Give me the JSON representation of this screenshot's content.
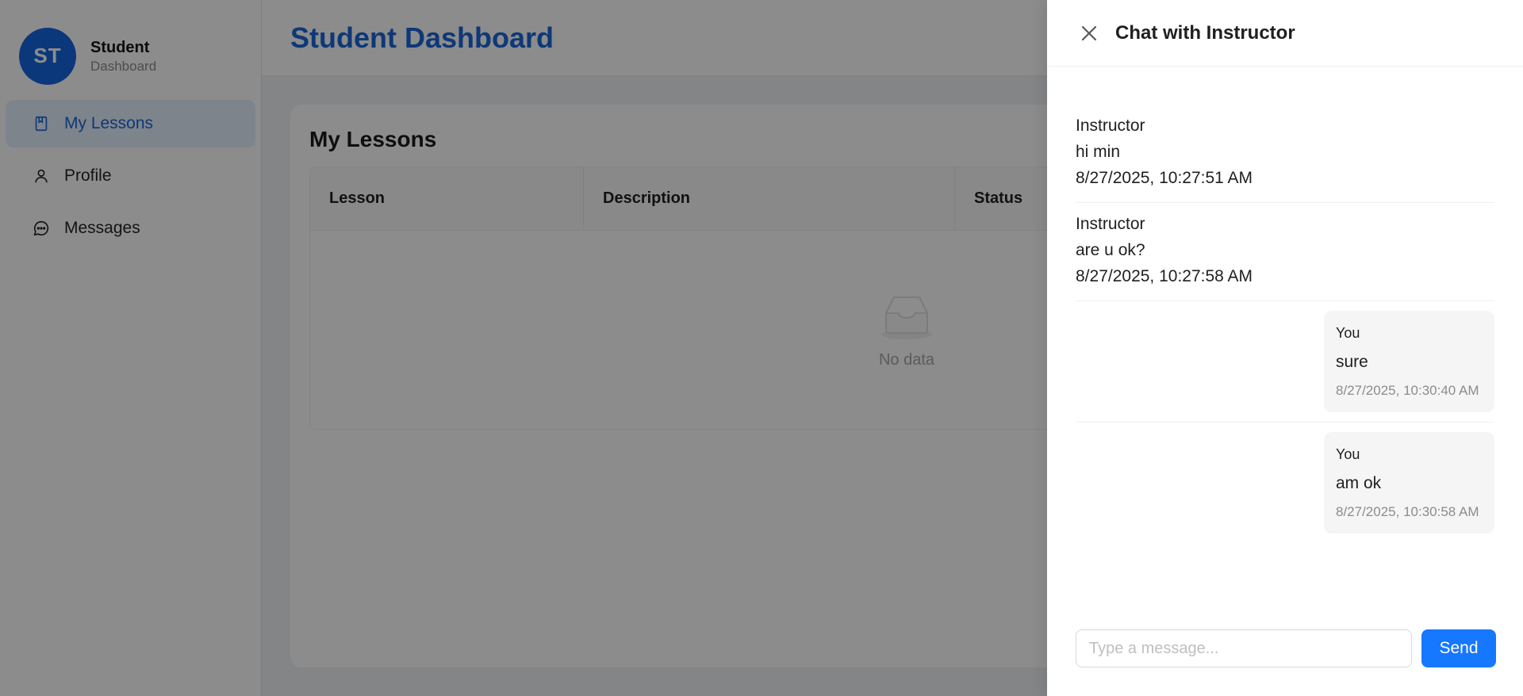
{
  "sidebar": {
    "avatar_initials": "ST",
    "title": "Student",
    "subtitle": "Dashboard",
    "items": [
      {
        "label": "My Lessons",
        "icon": "book-icon",
        "active": true
      },
      {
        "label": "Profile",
        "icon": "user-icon",
        "active": false
      },
      {
        "label": "Messages",
        "icon": "message-icon",
        "active": false
      }
    ]
  },
  "header": {
    "title": "Student Dashboard"
  },
  "lessons": {
    "title": "My Lessons",
    "columns": [
      "Lesson",
      "Description",
      "Status"
    ],
    "empty_text": "No data"
  },
  "drawer": {
    "title": "Chat with Instructor",
    "messages": [
      {
        "sender": "Instructor",
        "text": "hi min",
        "time": "8/27/2025, 10:27:51 AM",
        "mine": false
      },
      {
        "sender": "Instructor",
        "text": "are u ok?",
        "time": "8/27/2025, 10:27:58 AM",
        "mine": false
      },
      {
        "sender": "You",
        "text": "sure",
        "time": "8/27/2025, 10:30:40 AM",
        "mine": true
      },
      {
        "sender": "You",
        "text": "am ok",
        "time": "8/27/2025, 10:30:58 AM",
        "mine": true
      }
    ],
    "input_placeholder": "Type a message...",
    "input_value": "",
    "send_label": "Send"
  },
  "colors": {
    "primary": "#1a66d9",
    "send_button": "#1677ff",
    "active_bg": "#e6f0ff"
  }
}
